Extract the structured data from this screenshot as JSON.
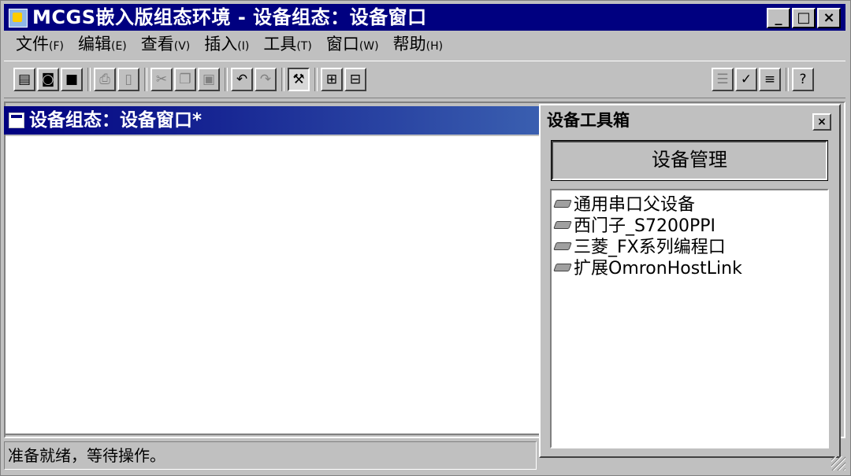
{
  "window": {
    "title": "MCGS嵌入版组态环境 - 设备组态：设备窗口"
  },
  "menu": [
    {
      "label": "文件",
      "accel": "(F)"
    },
    {
      "label": "编辑",
      "accel": "(E)"
    },
    {
      "label": "查看",
      "accel": "(V)"
    },
    {
      "label": "插入",
      "accel": "(I)"
    },
    {
      "label": "工具",
      "accel": "(T)"
    },
    {
      "label": "窗口",
      "accel": "(W)"
    },
    {
      "label": "帮助",
      "accel": "(H)"
    }
  ],
  "toolbar": {
    "icons": [
      "new-icon",
      "open-icon",
      "save-icon",
      "print-icon",
      "print-preview-icon",
      "cut-icon",
      "copy-icon",
      "paste-icon",
      "undo-icon",
      "redo-icon",
      "tools-icon",
      "device-tree-icon",
      "device-tree2-icon",
      "properties-icon",
      "check-icon",
      "compile-icon",
      "help-icon"
    ]
  },
  "child_window": {
    "title": "设备组态：设备窗口*"
  },
  "toolbox": {
    "title": "设备工具箱",
    "manage_button": "设备管理",
    "devices": [
      "通用串口父设备",
      "西门子_S7200PPI",
      "三菱_FX系列编程口",
      "扩展OmronHostLink"
    ]
  },
  "status": {
    "text": "准备就绪，等待操作。"
  }
}
